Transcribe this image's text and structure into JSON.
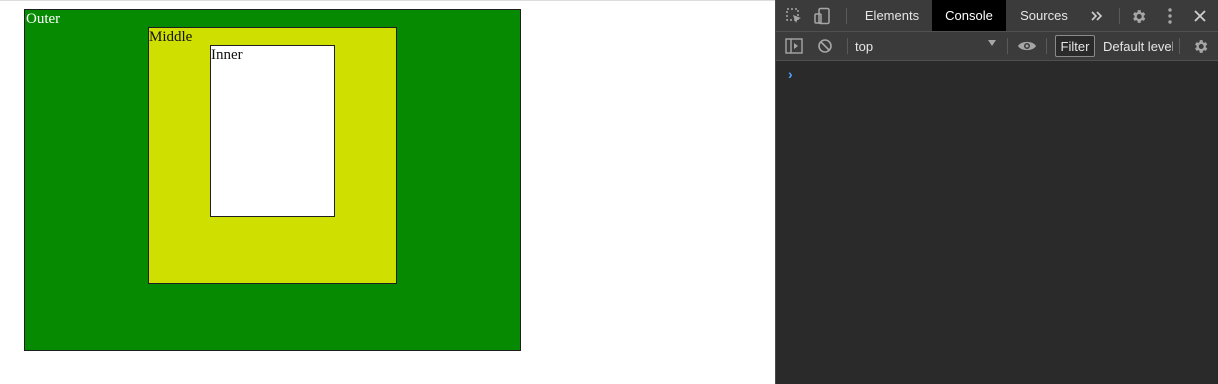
{
  "page": {
    "outer_label": "Outer",
    "middle_label": "Middle",
    "inner_label": "Inner",
    "colors": {
      "outer": "#058a01",
      "middle": "#cfdf00",
      "inner": "#ffffff"
    }
  },
  "devtools": {
    "tabs": [
      {
        "label": "Elements"
      },
      {
        "label": "Console"
      },
      {
        "label": "Sources"
      }
    ],
    "active_tab": "Console",
    "more_tabs_icon": "double-chevron-right-icon",
    "context": "top",
    "filter_label": "Filter",
    "levels_label": "Default levels",
    "console_prompt": "›"
  }
}
